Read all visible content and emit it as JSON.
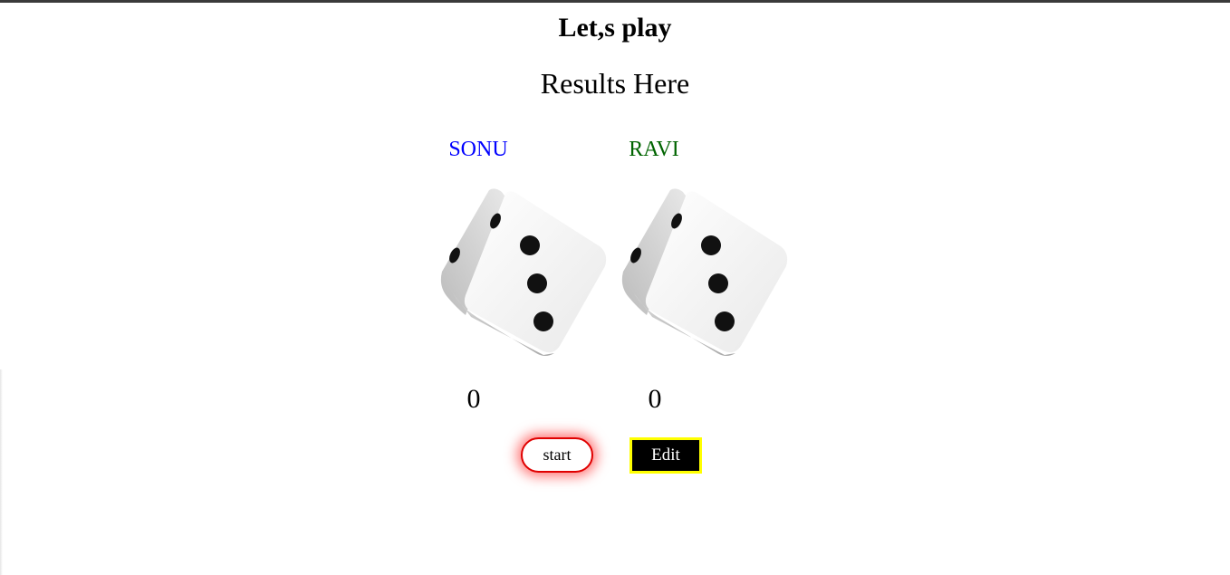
{
  "header": {
    "title": "Let,s play",
    "results": "Results Here"
  },
  "players": [
    {
      "name": "SONU",
      "score": "0",
      "die_value": 3,
      "color": "#0000ff"
    },
    {
      "name": "RAVI",
      "score": "0",
      "die_value": 3,
      "color": "#006400"
    }
  ],
  "buttons": {
    "start_label": "start",
    "edit_label": "Edit"
  },
  "colors": {
    "start_border": "#e00000",
    "edit_border": "#ffff00",
    "edit_background": "#000000"
  }
}
